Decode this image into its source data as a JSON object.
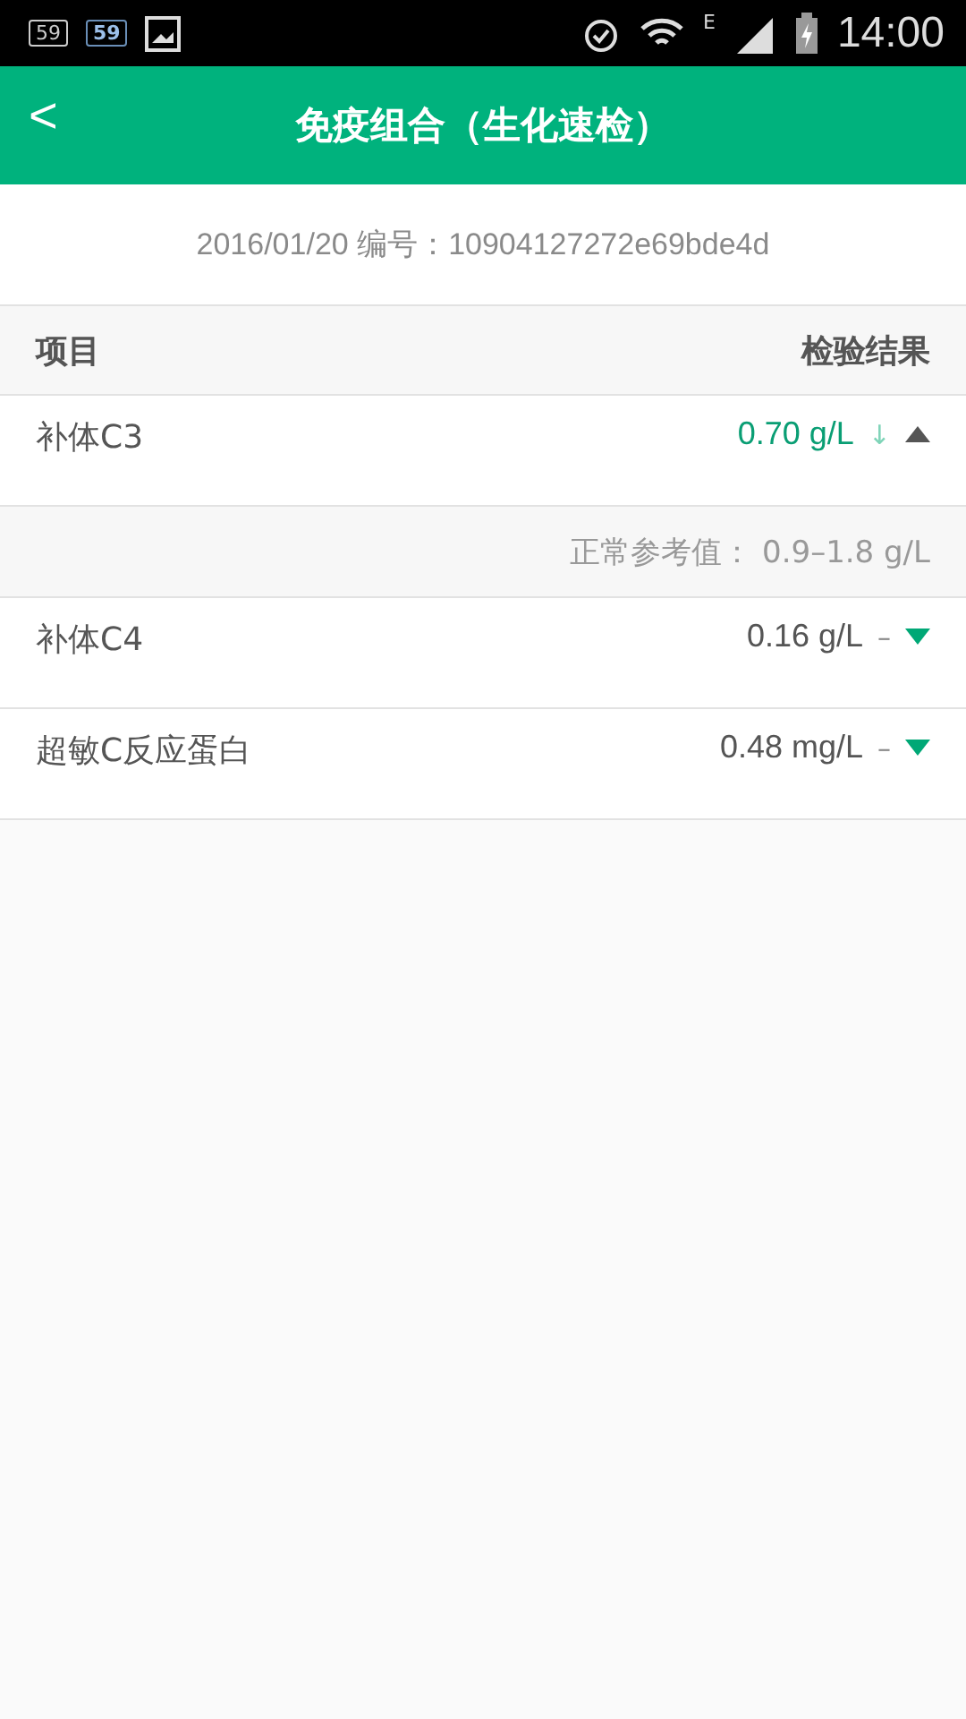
{
  "status_bar": {
    "badges": [
      "59",
      "59"
    ],
    "network": "E",
    "time": "14:00"
  },
  "app_bar": {
    "back": "<",
    "title": "免疫组合（生化速检）"
  },
  "info": "2016/01/20  编号：10904127272e69bde4d",
  "table": {
    "columns": [
      "项目",
      "检验结果"
    ],
    "rows": [
      {
        "name": "补体C3",
        "value": "0.70 g/L",
        "flag": "↓",
        "abnormal": true,
        "expanded": true,
        "reference": "正常参考值： 0.9–1.8 g/L"
      },
      {
        "name": "补体C4",
        "value": "0.16 g/L",
        "flag": "–",
        "abnormal": false,
        "expanded": false
      },
      {
        "name": "超敏C反应蛋白",
        "value": "0.48 mg/L",
        "flag": "–",
        "abnormal": false,
        "expanded": false
      }
    ]
  }
}
